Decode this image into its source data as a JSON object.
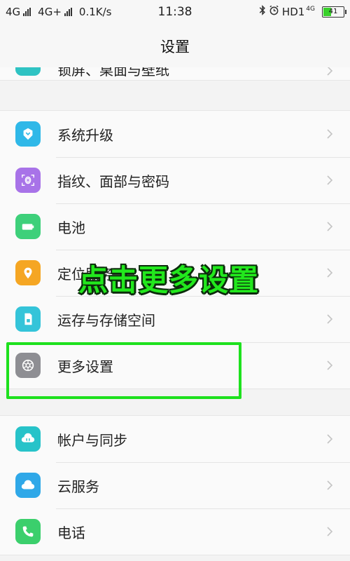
{
  "status_bar": {
    "net1": "4G",
    "net2": "4G+",
    "speed": "0.1K/s",
    "time": "11:38",
    "hd": "HD1",
    "net_sup": "4G",
    "battery": "41",
    "battery_level_percent": 41
  },
  "header": {
    "title": "设置"
  },
  "partial_item": {
    "label": "锁屏、桌面与壁纸",
    "icon": "wallpaper-icon",
    "color": "#2fc3c3"
  },
  "group1": [
    {
      "label": "系统升级",
      "icon": "system-update-icon",
      "color": "#2fb8e8"
    },
    {
      "label": "指纹、面部与密码",
      "icon": "fingerprint-icon",
      "color": "#a873e8"
    },
    {
      "label": "电池",
      "icon": "battery-icon",
      "color": "#3ed07a"
    },
    {
      "label": "定位服务",
      "icon": "location-icon",
      "color": "#f5a623"
    },
    {
      "label": "运存与存储空间",
      "icon": "storage-icon",
      "color": "#34c4d9"
    },
    {
      "label": "更多设置",
      "icon": "gear-icon",
      "color": "#8e8e93"
    }
  ],
  "group2": [
    {
      "label": "帐户与同步",
      "icon": "account-sync-icon",
      "color": "#27c3c9"
    },
    {
      "label": "云服务",
      "icon": "cloud-icon",
      "color": "#2fa8e8"
    },
    {
      "label": "电话",
      "icon": "phone-icon",
      "color": "#3bcf6c"
    }
  ],
  "annotation": {
    "text": "点击更多设置",
    "color": "#22e81d"
  }
}
